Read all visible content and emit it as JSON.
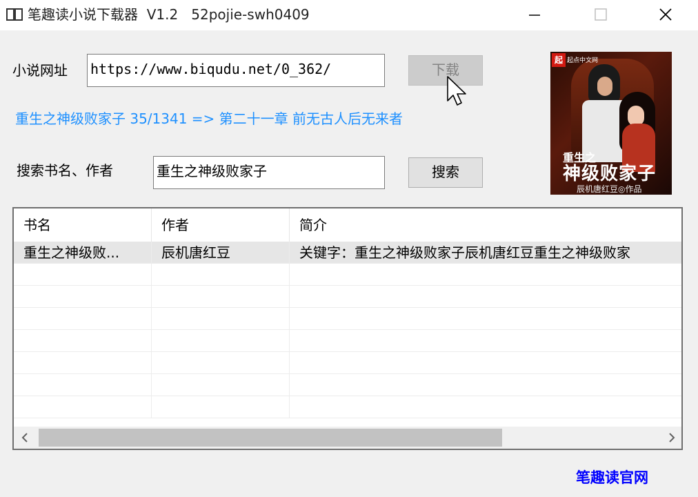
{
  "window": {
    "title": "笔趣读小说下载器  V1.2   52pojie-swh0409",
    "icon": "book-icon",
    "controls": [
      "minimize-icon",
      "maximize-icon",
      "close-icon"
    ]
  },
  "url_row": {
    "label": "小说网址",
    "value": "https://www.biqudu.net/0_362/",
    "download_button": "下载"
  },
  "status_text": "重生之神级败家子 35/1341 => 第二十一章 前无古人后无来者",
  "search_row": {
    "label": "搜索书名、作者",
    "value": "重生之神级败家子",
    "search_button": "搜索"
  },
  "cover": {
    "logo": "起",
    "logo_text": "起点中文网",
    "title_line1": "重生之",
    "title_line2": "神级败家子",
    "author_line": "辰机唐红豆◎作品"
  },
  "table": {
    "columns": [
      "书名",
      "作者",
      "简介"
    ],
    "rows": [
      [
        "重生之神级败...",
        "辰机唐红豆",
        "关键字：重生之神级败家子辰机唐红豆重生之神级败家"
      ]
    ]
  },
  "footer_link": "笔趣读官网",
  "colors": {
    "status": "#1e90ff",
    "link": "#0000ff"
  }
}
